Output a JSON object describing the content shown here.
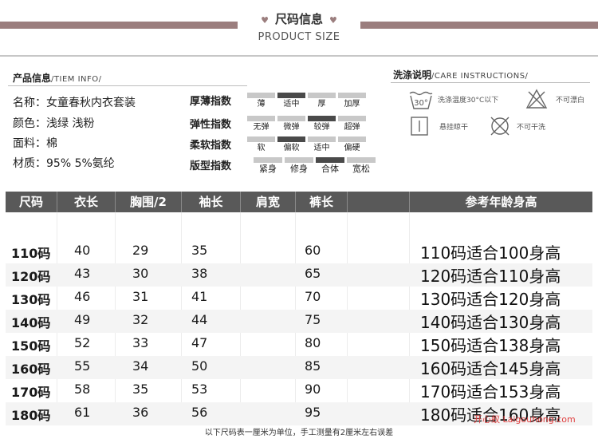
{
  "header": {
    "title": "尺码信息",
    "subtitle": "PRODUCT SIZE"
  },
  "product_info": {
    "title": "产品信息",
    "title_en": "/TIEM INFO/",
    "lines": [
      "名称：女童春秋内衣套装",
      "颜色：浅绿   浅粉",
      "面料：棉",
      "材质：95%   5%氨纶"
    ]
  },
  "indices": [
    {
      "label": "厚薄指数",
      "options": [
        "薄",
        "适中",
        "厚",
        "加厚"
      ],
      "selected": 1
    },
    {
      "label": "弹性指数",
      "options": [
        "无弹",
        "微弹",
        "较弹",
        "超弹"
      ],
      "selected": 2
    },
    {
      "label": "柔软指数",
      "options": [
        "软",
        "偏软",
        "适中",
        "偏硬"
      ],
      "selected": 1
    },
    {
      "label": "版型指数",
      "options": [
        "紧身",
        "修身",
        "合体",
        "宽松"
      ],
      "selected": 2
    }
  ],
  "care": {
    "title": "洗涤说明",
    "title_en": "/CARE INSTRUCTIONS/",
    "items": [
      {
        "icon": "wash-30-icon",
        "icon_text": "30°",
        "text": "洗涤温度30°C以下"
      },
      {
        "icon": "no-bleach-icon",
        "text": "不可漂白"
      },
      {
        "icon": "hang-dry-icon",
        "text": "悬挂晾干"
      },
      {
        "icon": "no-dry-clean-icon",
        "text": "不可干洗"
      }
    ]
  },
  "table": {
    "headers": [
      "尺码",
      "衣长",
      "胸围/2",
      "袖长",
      "肩宽",
      "裤长",
      "参考年龄身高"
    ],
    "rows": [
      [
        "110码",
        "40",
        "29",
        "35",
        "",
        "60",
        "110码适合100身高"
      ],
      [
        "120码",
        "43",
        "30",
        "38",
        "",
        "65",
        "120码适合110身高"
      ],
      [
        "130码",
        "46",
        "31",
        "41",
        "",
        "70",
        "130码适合120身高"
      ],
      [
        "140码",
        "49",
        "32",
        "44",
        "",
        "75",
        "140码适合130身高"
      ],
      [
        "150码",
        "52",
        "33",
        "47",
        "",
        "80",
        "150码适合138身高"
      ],
      [
        "160码",
        "55",
        "34",
        "50",
        "",
        "85",
        "160码适合145身高"
      ],
      [
        "170码",
        "58",
        "35",
        "53",
        "",
        "90",
        "170码适合153身高"
      ],
      [
        "180码",
        "61",
        "36",
        "56",
        "",
        "95",
        "180码适合160身高"
      ]
    ]
  },
  "footnote": "以下尺码表一厘米为单位，手工测量有2厘米左右误差",
  "watermark": "开心蚁 Laigouhong.com",
  "colors": {
    "accent": "#9b7e7e",
    "table_header": "#595959",
    "scale_selected": "#4a4a4a",
    "scale_unselected": "#c8c8c8"
  }
}
